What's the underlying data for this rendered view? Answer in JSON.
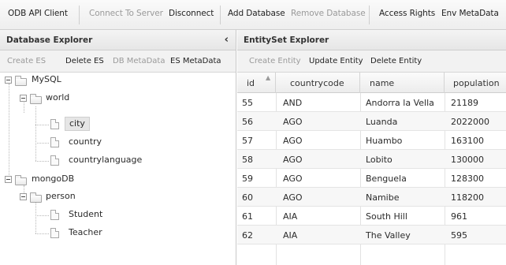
{
  "toolbar": {
    "items": [
      {
        "label": "ODB API Client",
        "disabled": false
      },
      {
        "label": "Connect To Server",
        "disabled": true
      },
      {
        "label": "Disconnect",
        "disabled": false
      },
      {
        "label": "Add Database",
        "disabled": false
      },
      {
        "label": "Remove Database",
        "disabled": true
      },
      {
        "label": "Access Rights",
        "disabled": false
      },
      {
        "label": "Env MetaData",
        "disabled": false
      }
    ]
  },
  "database_explorer": {
    "title": "Database Explorer",
    "collapse_icon": "chevron-left-icon",
    "actions": [
      {
        "label": "Create ES",
        "disabled": true
      },
      {
        "label": "Delete ES",
        "disabled": false
      },
      {
        "label": "DB MetaData",
        "disabled": true
      },
      {
        "label": "ES MetaData",
        "disabled": false
      }
    ],
    "tree": {
      "mysql": "MySQL",
      "world": "world",
      "city": "city",
      "country": "country",
      "countrylanguage": "countrylanguage",
      "mongodb": "mongoDB",
      "person": "person",
      "student": "Student",
      "teacher": "Teacher",
      "selected": "city"
    }
  },
  "entityset_explorer": {
    "title": "EntitySet Explorer",
    "actions": [
      {
        "label": "Create Entity",
        "disabled": true
      },
      {
        "label": "Update Entity",
        "disabled": false
      },
      {
        "label": "Delete Entity",
        "disabled": false
      }
    ],
    "columns": [
      "id",
      "countrycode",
      "name",
      "population"
    ],
    "rows": [
      [
        "55",
        "AND",
        "Andorra la Vella",
        "21189"
      ],
      [
        "56",
        "AGO",
        "Luanda",
        "2022000"
      ],
      [
        "57",
        "AGO",
        "Huambo",
        "163100"
      ],
      [
        "58",
        "AGO",
        "Lobito",
        "130000"
      ],
      [
        "59",
        "AGO",
        "Benguela",
        "128300"
      ],
      [
        "60",
        "AGO",
        "Namibe",
        "118200"
      ],
      [
        "61",
        "AIA",
        "South Hill",
        "961"
      ],
      [
        "62",
        "AIA",
        "The Valley",
        "595"
      ]
    ]
  }
}
